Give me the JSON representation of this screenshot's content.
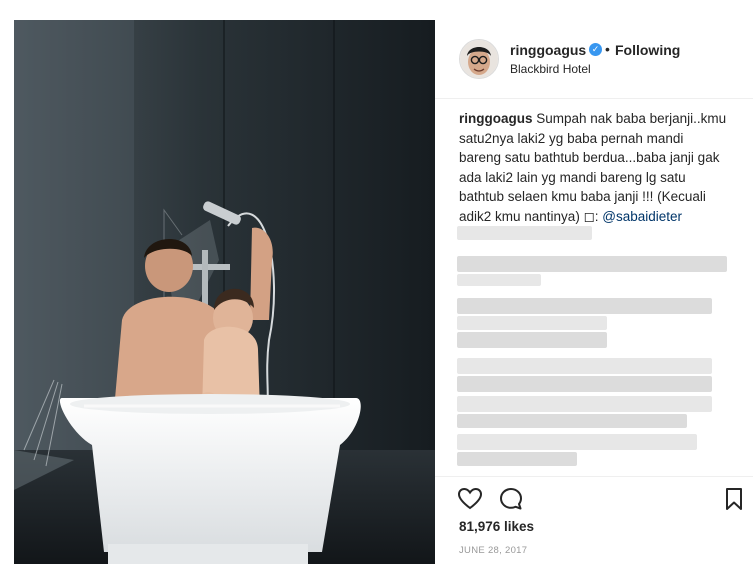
{
  "post": {
    "username": "ringgoagus",
    "verified_mark": "✓",
    "separator": "•",
    "follow_status": "Following",
    "location": "Blackbird Hotel",
    "caption": {
      "user": "ringgoagus",
      "lines": [
        " Sumpah nak baba berjanji..kmu",
        "satu2nya laki2 yg baba pernah mandi",
        "bareng satu bathtub berdua...baba janji gak",
        "ada laki2 lain yg mandi bareng lg satu",
        "bathtub selaen kmu baba janji !!! (Kecuali"
      ],
      "last_line_text": "adik2 kmu nantinya) ◻: ",
      "mention": "@sabaidieter"
    },
    "likes": "81,976 likes",
    "date": "JUNE 28, 2017"
  },
  "icons": {
    "like": "heart-icon",
    "comment": "comment-icon",
    "save": "bookmark-icon"
  },
  "colors": {
    "text": "#262626",
    "verified": "#3897f0",
    "mention": "#003569",
    "muted": "#999999",
    "border": "#efefef"
  }
}
